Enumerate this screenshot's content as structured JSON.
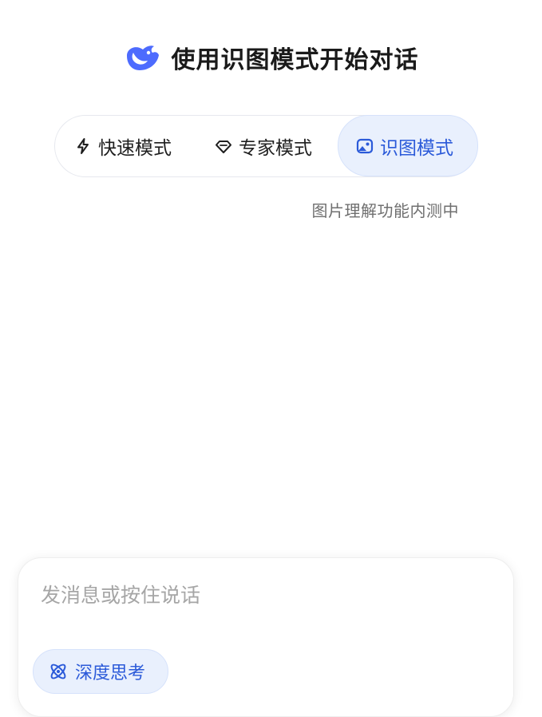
{
  "header": {
    "title": "使用识图模式开始对话",
    "logo_icon": "whale-logo-icon"
  },
  "modes": {
    "fast": {
      "label": "快速模式",
      "icon": "lightning-icon"
    },
    "expert": {
      "label": "专家模式",
      "icon": "diamond-icon"
    },
    "vision": {
      "label": "识图模式",
      "icon": "image-icon",
      "selected": true
    },
    "subtitle": "图片理解功能内测中"
  },
  "composer": {
    "placeholder": "发消息或按住说话",
    "deep_think_label": "深度思考",
    "deep_think_icon": "atom-icon"
  },
  "colors": {
    "accent": "#2b5ad9",
    "selected_bg": "#e9f0fd",
    "logo": "#4d6bfe"
  }
}
